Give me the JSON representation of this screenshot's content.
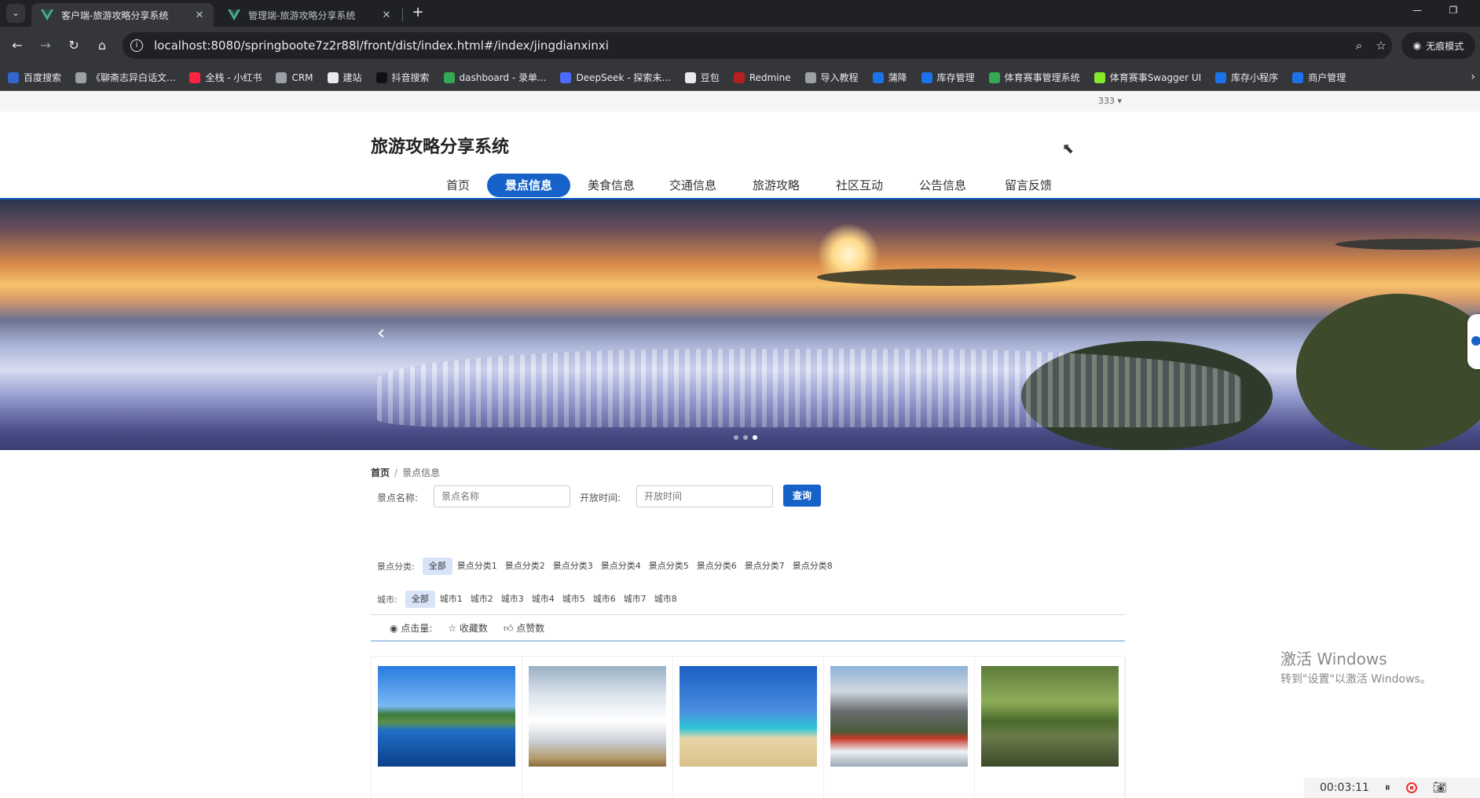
{
  "browser": {
    "tabs": [
      {
        "title": "客户端-旅游攻略分享系统",
        "active": true
      },
      {
        "title": "管理端-旅游攻略分享系统",
        "active": false
      }
    ],
    "new_tab": "+",
    "url": "localhost:8080/springboote7z2r88l/front/dist/index.html#/index/jingdianxinxi",
    "incognito_label": "无痕模式",
    "bookmarks": [
      {
        "label": "百度搜索",
        "color": "#3366cc"
      },
      {
        "label": "《聊斋志异白话文...",
        "color": "#9aa0a6"
      },
      {
        "label": "全栈 - 小红书",
        "color": "#ff2442"
      },
      {
        "label": "CRM",
        "color": "#9aa0a6"
      },
      {
        "label": "建站",
        "color": "#e8eaed"
      },
      {
        "label": "抖音搜索",
        "color": "#111111"
      },
      {
        "label": "dashboard - 录单...",
        "color": "#34a853"
      },
      {
        "label": "DeepSeek - 探索未...",
        "color": "#4d6bfe"
      },
      {
        "label": "豆包",
        "color": "#e8eaed"
      },
      {
        "label": "Redmine",
        "color": "#b32024"
      },
      {
        "label": "导入教程",
        "color": "#9aa0a6"
      },
      {
        "label": "蒲降",
        "color": "#1a73e8"
      },
      {
        "label": "库存管理",
        "color": "#1a73e8"
      },
      {
        "label": "体育赛事管理系统",
        "color": "#34a853"
      },
      {
        "label": "体育赛事Swagger UI",
        "color": "#85ea2d"
      },
      {
        "label": "库存小程序",
        "color": "#1a73e8"
      },
      {
        "label": "商户管理",
        "color": "#1a73e8"
      }
    ]
  },
  "header": {
    "user_menu": "333 ▾",
    "site_title": "旅游攻略分享系统"
  },
  "nav": {
    "items": [
      "首页",
      "景点信息",
      "美食信息",
      "交通信息",
      "旅游攻略",
      "社区互动",
      "公告信息",
      "留言反馈"
    ],
    "active": "景点信息"
  },
  "banner": {
    "prev": "‹",
    "slide_count": 3,
    "current_slide": 3
  },
  "breadcrumb": {
    "home": "首页",
    "separator": "/",
    "current": "景点信息"
  },
  "search": {
    "name_label": "景点名称:",
    "name_placeholder": "景点名称",
    "time_label": "开放时间:",
    "time_placeholder": "开放时间",
    "button": "查询"
  },
  "filters": {
    "category_label": "景点分类:",
    "categories": [
      "全部",
      "景点分类1",
      "景点分类2",
      "景点分类3",
      "景点分类4",
      "景点分类5",
      "景点分类6",
      "景点分类7",
      "景点分类8"
    ],
    "city_label": "城市:",
    "cities": [
      "全部",
      "城市1",
      "城市2",
      "城市3",
      "城市4",
      "城市5",
      "城市6",
      "城市7",
      "城市8"
    ]
  },
  "sort": {
    "views": "点击量:",
    "favorites": "收藏数",
    "likes": "点赞数"
  },
  "cards": [
    {
      "scene": "lake-city"
    },
    {
      "scene": "sea-of-clouds"
    },
    {
      "scene": "beach-umbrella"
    },
    {
      "scene": "snow-mountain-village"
    },
    {
      "scene": "willow-pond"
    }
  ],
  "os": {
    "watermark_title": "激活 Windows",
    "watermark_sub": "转到\"设置\"以激活 Windows。",
    "recorder_time": "00:03:11"
  }
}
